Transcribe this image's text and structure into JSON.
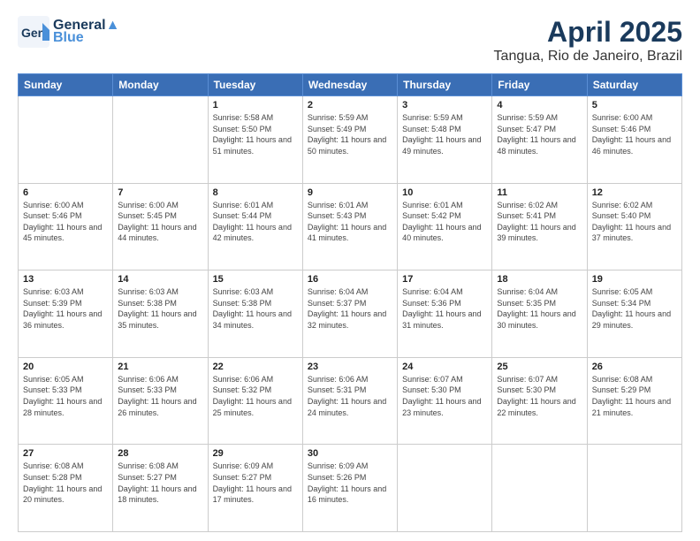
{
  "logo": {
    "line1": "General",
    "line2": "Blue"
  },
  "header": {
    "month": "April 2025",
    "location": "Tangua, Rio de Janeiro, Brazil"
  },
  "days_of_week": [
    "Sunday",
    "Monday",
    "Tuesday",
    "Wednesday",
    "Thursday",
    "Friday",
    "Saturday"
  ],
  "weeks": [
    [
      {
        "day": "",
        "info": ""
      },
      {
        "day": "",
        "info": ""
      },
      {
        "day": "1",
        "info": "Sunrise: 5:58 AM\nSunset: 5:50 PM\nDaylight: 11 hours and 51 minutes."
      },
      {
        "day": "2",
        "info": "Sunrise: 5:59 AM\nSunset: 5:49 PM\nDaylight: 11 hours and 50 minutes."
      },
      {
        "day": "3",
        "info": "Sunrise: 5:59 AM\nSunset: 5:48 PM\nDaylight: 11 hours and 49 minutes."
      },
      {
        "day": "4",
        "info": "Sunrise: 5:59 AM\nSunset: 5:47 PM\nDaylight: 11 hours and 48 minutes."
      },
      {
        "day": "5",
        "info": "Sunrise: 6:00 AM\nSunset: 5:46 PM\nDaylight: 11 hours and 46 minutes."
      }
    ],
    [
      {
        "day": "6",
        "info": "Sunrise: 6:00 AM\nSunset: 5:46 PM\nDaylight: 11 hours and 45 minutes."
      },
      {
        "day": "7",
        "info": "Sunrise: 6:00 AM\nSunset: 5:45 PM\nDaylight: 11 hours and 44 minutes."
      },
      {
        "day": "8",
        "info": "Sunrise: 6:01 AM\nSunset: 5:44 PM\nDaylight: 11 hours and 42 minutes."
      },
      {
        "day": "9",
        "info": "Sunrise: 6:01 AM\nSunset: 5:43 PM\nDaylight: 11 hours and 41 minutes."
      },
      {
        "day": "10",
        "info": "Sunrise: 6:01 AM\nSunset: 5:42 PM\nDaylight: 11 hours and 40 minutes."
      },
      {
        "day": "11",
        "info": "Sunrise: 6:02 AM\nSunset: 5:41 PM\nDaylight: 11 hours and 39 minutes."
      },
      {
        "day": "12",
        "info": "Sunrise: 6:02 AM\nSunset: 5:40 PM\nDaylight: 11 hours and 37 minutes."
      }
    ],
    [
      {
        "day": "13",
        "info": "Sunrise: 6:03 AM\nSunset: 5:39 PM\nDaylight: 11 hours and 36 minutes."
      },
      {
        "day": "14",
        "info": "Sunrise: 6:03 AM\nSunset: 5:38 PM\nDaylight: 11 hours and 35 minutes."
      },
      {
        "day": "15",
        "info": "Sunrise: 6:03 AM\nSunset: 5:38 PM\nDaylight: 11 hours and 34 minutes."
      },
      {
        "day": "16",
        "info": "Sunrise: 6:04 AM\nSunset: 5:37 PM\nDaylight: 11 hours and 32 minutes."
      },
      {
        "day": "17",
        "info": "Sunrise: 6:04 AM\nSunset: 5:36 PM\nDaylight: 11 hours and 31 minutes."
      },
      {
        "day": "18",
        "info": "Sunrise: 6:04 AM\nSunset: 5:35 PM\nDaylight: 11 hours and 30 minutes."
      },
      {
        "day": "19",
        "info": "Sunrise: 6:05 AM\nSunset: 5:34 PM\nDaylight: 11 hours and 29 minutes."
      }
    ],
    [
      {
        "day": "20",
        "info": "Sunrise: 6:05 AM\nSunset: 5:33 PM\nDaylight: 11 hours and 28 minutes."
      },
      {
        "day": "21",
        "info": "Sunrise: 6:06 AM\nSunset: 5:33 PM\nDaylight: 11 hours and 26 minutes."
      },
      {
        "day": "22",
        "info": "Sunrise: 6:06 AM\nSunset: 5:32 PM\nDaylight: 11 hours and 25 minutes."
      },
      {
        "day": "23",
        "info": "Sunrise: 6:06 AM\nSunset: 5:31 PM\nDaylight: 11 hours and 24 minutes."
      },
      {
        "day": "24",
        "info": "Sunrise: 6:07 AM\nSunset: 5:30 PM\nDaylight: 11 hours and 23 minutes."
      },
      {
        "day": "25",
        "info": "Sunrise: 6:07 AM\nSunset: 5:30 PM\nDaylight: 11 hours and 22 minutes."
      },
      {
        "day": "26",
        "info": "Sunrise: 6:08 AM\nSunset: 5:29 PM\nDaylight: 11 hours and 21 minutes."
      }
    ],
    [
      {
        "day": "27",
        "info": "Sunrise: 6:08 AM\nSunset: 5:28 PM\nDaylight: 11 hours and 20 minutes."
      },
      {
        "day": "28",
        "info": "Sunrise: 6:08 AM\nSunset: 5:27 PM\nDaylight: 11 hours and 18 minutes."
      },
      {
        "day": "29",
        "info": "Sunrise: 6:09 AM\nSunset: 5:27 PM\nDaylight: 11 hours and 17 minutes."
      },
      {
        "day": "30",
        "info": "Sunrise: 6:09 AM\nSunset: 5:26 PM\nDaylight: 11 hours and 16 minutes."
      },
      {
        "day": "",
        "info": ""
      },
      {
        "day": "",
        "info": ""
      },
      {
        "day": "",
        "info": ""
      }
    ]
  ]
}
